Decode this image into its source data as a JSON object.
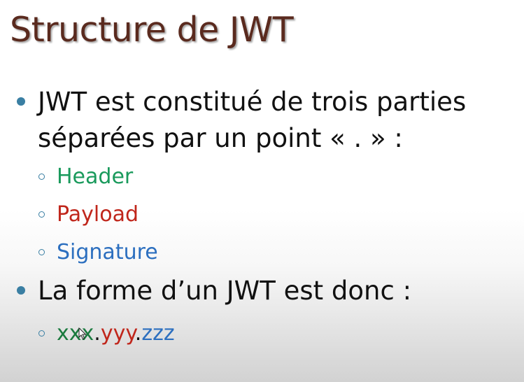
{
  "slide": {
    "title": "Structure de JWT",
    "bullets": [
      {
        "line1": "JWT est constitué de trois parties",
        "line2": "séparées par un point « . » :",
        "sub": [
          {
            "label": "Header",
            "color": "#1a9a5c"
          },
          {
            "label": "Payload",
            "color": "#c0261b"
          },
          {
            "label": "Signature",
            "color": "#2c6fbf"
          }
        ]
      },
      {
        "line1": "La forme d’un JWT est donc :",
        "example": {
          "part1": "xxx",
          "sep1": ".",
          "part2": "yyy",
          "sep2": ".",
          "part3": "zzz"
        }
      }
    ]
  },
  "colors": {
    "title": "#5a2a1e",
    "bullet_marker": "#3a7fa3",
    "header": "#1a9a5c",
    "payload": "#c0261b",
    "signature": "#2c6fbf"
  },
  "icons": {
    "cursor": "mouse-pointer-icon"
  }
}
